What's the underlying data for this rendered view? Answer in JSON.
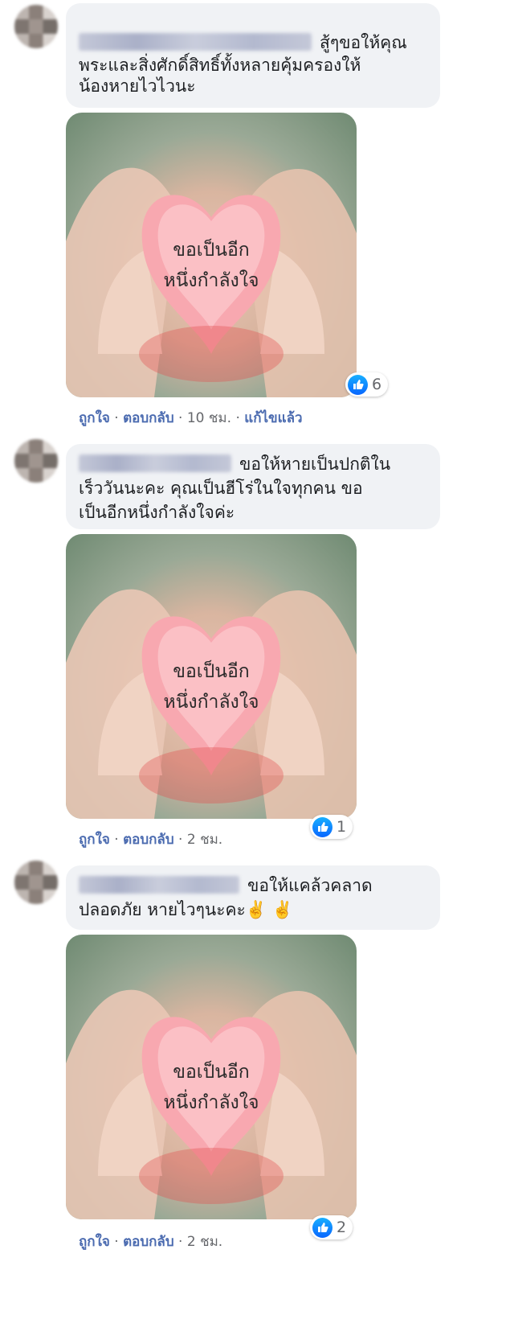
{
  "comments": [
    {
      "text": "สู้ๆขอให้คุณพระและสิ่งศักดิ์สิทธิ์ทั้งหลายคุ้มครองให้น้องหายไวไวนะ",
      "line1": "สู้ๆขอให้คุณ",
      "line2": "พระและสิ่งศักดิ์สิทธิ์ทั้งหลายคุ้มครองให้",
      "line3": "น้องหายไวไวนะ",
      "image_text_1": "ขอเป็นอีก",
      "image_text_2": "หนึ่งกำลังใจ",
      "reaction_count": "6",
      "like_label": "ถูกใจ",
      "reply_label": "ตอบกลับ",
      "time": "10 ชม.",
      "edited": "แก้ไขแล้ว",
      "separator": "·"
    },
    {
      "line1": "ขอให้หายเป็นปกติใน",
      "line2": "เร็ววันนะคะ คุณเป็นฮีโร่ในใจทุกคน ขอ",
      "line3": "เป็นอีกหนึ่งกำลังใจค่ะ",
      "image_text_1": "ขอเป็นอีก",
      "image_text_2": "หนึ่งกำลังใจ",
      "reaction_count": "1",
      "like_label": "ถูกใจ",
      "reply_label": "ตอบกลับ",
      "time": "2 ชม.",
      "separator": "·"
    },
    {
      "line1": "ขอให้แคล้วคลาด",
      "line2": "ปลอดภัย หายไวๆนะคะ✌️ ✌️",
      "image_text_1": "ขอเป็นอีก",
      "image_text_2": "หนึ่งกำลังใจ",
      "reaction_count": "2",
      "like_label": "ถูกใจ",
      "reply_label": "ตอบกลับ",
      "time": "2 ชม.",
      "separator": "·"
    }
  ],
  "icons": {
    "reaction": "like-icon",
    "avatar": "avatar"
  },
  "colors": {
    "bubble": "#f0f2f5",
    "like": "#0866ff",
    "meta_link": "#4b6bb0",
    "meta_text": "#65676b"
  }
}
